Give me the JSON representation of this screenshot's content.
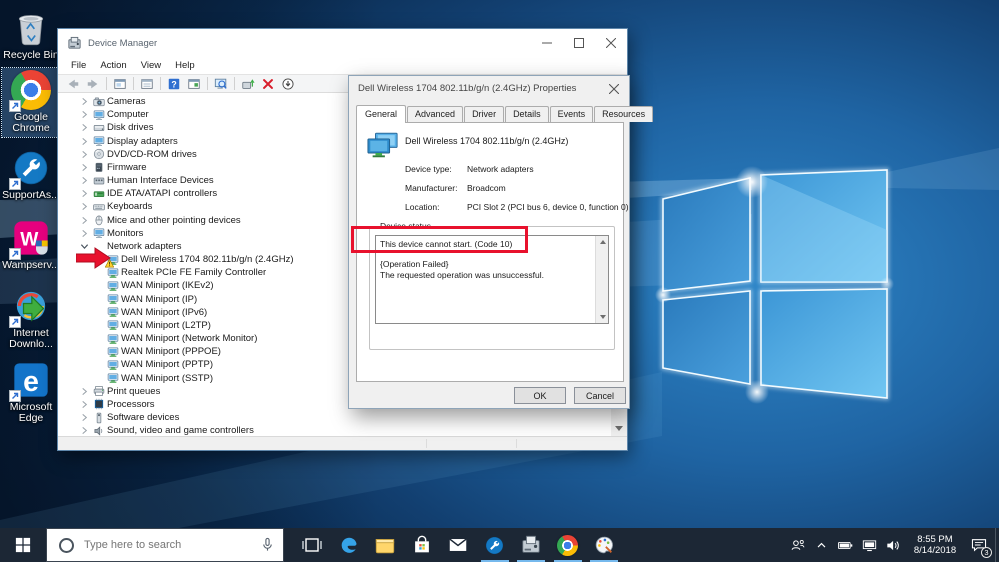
{
  "colors": {
    "accent_underline": "#76b9ed",
    "annotation_red": "#e8112d",
    "taskbar_bg": "#1c2735",
    "selection_blue": "#649bd2"
  },
  "desktop": {
    "icons": [
      {
        "icon": "recycle-bin",
        "label": "Recycle Bin",
        "shortcut": false,
        "selected": false
      },
      {
        "icon": "chrome",
        "label": "Google Chrome",
        "shortcut": true,
        "selected": true
      },
      {
        "icon": "supportassist",
        "label": "SupportAs...",
        "shortcut": true,
        "selected": false
      },
      {
        "icon": "wampserver",
        "label": "Wampserv...",
        "shortcut": true,
        "selected": false
      },
      {
        "icon": "idm",
        "label": "Internet Downlo...",
        "shortcut": true,
        "selected": false
      },
      {
        "icon": "edge",
        "label": "Microsoft Edge",
        "shortcut": true,
        "selected": false
      }
    ]
  },
  "device_manager": {
    "title": "Device Manager",
    "menu_items": [
      "File",
      "Action",
      "View",
      "Help"
    ],
    "toolbar": [
      "back",
      "forward",
      "|",
      "console-tree",
      "|",
      "export-list",
      "|",
      "help",
      "properties",
      "|",
      "scan-hardware-changes",
      "|",
      "update-driver",
      "uninstall-device",
      "disable-device"
    ],
    "tree": [
      {
        "label": "Cameras",
        "icon": "camera",
        "level": 0,
        "state": "collapsed"
      },
      {
        "label": "Computer",
        "icon": "computer",
        "level": 0,
        "state": "collapsed"
      },
      {
        "label": "Disk drives",
        "icon": "disk",
        "level": 0,
        "state": "collapsed"
      },
      {
        "label": "Display adapters",
        "icon": "display",
        "level": 0,
        "state": "collapsed"
      },
      {
        "label": "DVD/CD-ROM drives",
        "icon": "dvd",
        "level": 0,
        "state": "collapsed"
      },
      {
        "label": "Firmware",
        "icon": "firmware",
        "level": 0,
        "state": "collapsed"
      },
      {
        "label": "Human Interface Devices",
        "icon": "hid",
        "level": 0,
        "state": "collapsed"
      },
      {
        "label": "IDE ATA/ATAPI controllers",
        "icon": "ide",
        "level": 0,
        "state": "collapsed"
      },
      {
        "label": "Keyboards",
        "icon": "keyboard",
        "level": 0,
        "state": "collapsed"
      },
      {
        "label": "Mice and other pointing devices",
        "icon": "mouse",
        "level": 0,
        "state": "collapsed"
      },
      {
        "label": "Monitors",
        "icon": "monitor",
        "level": 0,
        "state": "collapsed"
      },
      {
        "label": "Network adapters",
        "icon": "network",
        "level": 0,
        "state": "expanded"
      },
      {
        "label": "Dell Wireless 1704 802.11b/g/n (2.4GHz)",
        "icon": "netadapter",
        "level": 1,
        "state": "none",
        "warning": true,
        "annotated": true
      },
      {
        "label": "Realtek PCIe FE Family Controller",
        "icon": "netadapter",
        "level": 1,
        "state": "none"
      },
      {
        "label": "WAN Miniport (IKEv2)",
        "icon": "netadapter",
        "level": 1,
        "state": "none"
      },
      {
        "label": "WAN Miniport (IP)",
        "icon": "netadapter",
        "level": 1,
        "state": "none"
      },
      {
        "label": "WAN Miniport (IPv6)",
        "icon": "netadapter",
        "level": 1,
        "state": "none"
      },
      {
        "label": "WAN Miniport (L2TP)",
        "icon": "netadapter",
        "level": 1,
        "state": "none"
      },
      {
        "label": "WAN Miniport (Network Monitor)",
        "icon": "netadapter",
        "level": 1,
        "state": "none"
      },
      {
        "label": "WAN Miniport (PPPOE)",
        "icon": "netadapter",
        "level": 1,
        "state": "none"
      },
      {
        "label": "WAN Miniport (PPTP)",
        "icon": "netadapter",
        "level": 1,
        "state": "none"
      },
      {
        "label": "WAN Miniport (SSTP)",
        "icon": "netadapter",
        "level": 1,
        "state": "none"
      },
      {
        "label": "Print queues",
        "icon": "printer",
        "level": 0,
        "state": "collapsed"
      },
      {
        "label": "Processors",
        "icon": "processor",
        "level": 0,
        "state": "collapsed"
      },
      {
        "label": "Software devices",
        "icon": "software",
        "level": 0,
        "state": "collapsed"
      },
      {
        "label": "Sound, video and game controllers",
        "icon": "sound",
        "level": 0,
        "state": "collapsed"
      }
    ]
  },
  "dialog": {
    "title": "Dell Wireless 1704 802.11b/g/n (2.4GHz) Properties",
    "tabs": [
      {
        "label": "General",
        "active": true
      },
      {
        "label": "Advanced",
        "active": false
      },
      {
        "label": "Driver",
        "active": false
      },
      {
        "label": "Details",
        "active": false
      },
      {
        "label": "Events",
        "active": false
      },
      {
        "label": "Resources",
        "active": false
      }
    ],
    "device_name": "Dell Wireless 1704 802.11b/g/n (2.4GHz)",
    "fields": [
      {
        "label": "Device type:",
        "value": "Network adapters"
      },
      {
        "label": "Manufacturer:",
        "value": "Broadcom"
      },
      {
        "label": "Location:",
        "value": "PCI Slot 2 (PCI bus 6, device 0, function 0)"
      }
    ],
    "group_label": "Device status",
    "status_lines": [
      "This device cannot start. (Code 10)",
      "",
      "{Operation Failed}",
      "The requested operation was unsuccessful."
    ],
    "ok_label": "OK",
    "cancel_label": "Cancel"
  },
  "taskbar": {
    "search_placeholder": "Type here to search",
    "apps": [
      {
        "icon": "task-view",
        "running": false
      },
      {
        "icon": "edge",
        "running": false
      },
      {
        "icon": "file-explorer",
        "running": false
      },
      {
        "icon": "store",
        "running": false
      },
      {
        "icon": "mail",
        "running": false
      },
      {
        "icon": "supportassist",
        "running": true
      },
      {
        "icon": "device-manager",
        "running": true
      },
      {
        "icon": "chrome",
        "running": true
      },
      {
        "icon": "paint-3d",
        "running": true
      }
    ],
    "tray_icons": [
      "people",
      "chevron-up",
      "battery",
      "network",
      "volume"
    ],
    "clock": {
      "time": "8:55 PM",
      "date": "8/14/2018"
    },
    "action_center_badge": "3"
  }
}
